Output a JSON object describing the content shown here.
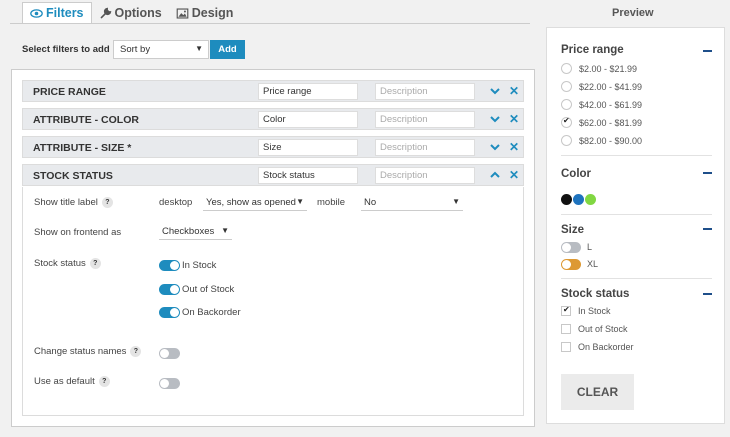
{
  "tabs": [
    {
      "label": "Filters",
      "icon": "eye-icon",
      "active": true
    },
    {
      "label": "Options",
      "icon": "wrench-icon",
      "active": false
    },
    {
      "label": "Design",
      "icon": "image-icon",
      "active": false
    }
  ],
  "toolbar": {
    "select_label": "Select filters to add",
    "sort_value": "Sort by",
    "add_label": "Add"
  },
  "filters": [
    {
      "title": "PRICE RANGE",
      "label_value": "Price range",
      "description_placeholder": "Description",
      "expanded": false
    },
    {
      "title": "ATTRIBUTE - COLOR",
      "label_value": "Color",
      "description_placeholder": "Description",
      "expanded": false
    },
    {
      "title": "ATTRIBUTE - SIZE *",
      "label_value": "Size",
      "description_placeholder": "Description",
      "expanded": false
    },
    {
      "title": "STOCK STATUS",
      "label_value": "Stock status",
      "description_placeholder": "Description",
      "expanded": true
    }
  ],
  "stock_options": {
    "show_title_label": "Show title label",
    "desktop_label": "desktop",
    "desktop_value": "Yes, show as opened",
    "mobile_label": "mobile",
    "mobile_value": "No",
    "show_frontend_label": "Show on frontend as",
    "frontend_value": "Checkboxes",
    "stock_status_label": "Stock status",
    "statuses": [
      {
        "label": "In Stock",
        "on": true
      },
      {
        "label": "Out of Stock",
        "on": true
      },
      {
        "label": "On Backorder",
        "on": true
      }
    ],
    "change_names_label": "Change status names",
    "change_names_on": false,
    "use_default_label": "Use as default",
    "use_default_on": false
  },
  "preview": {
    "title": "Preview",
    "price_range": {
      "heading": "Price range",
      "options": [
        {
          "label": "$2.00 - $21.99",
          "checked": false
        },
        {
          "label": "$22.00 - $41.99",
          "checked": false
        },
        {
          "label": "$42.00 - $61.99",
          "checked": false
        },
        {
          "label": "$62.00 - $81.99",
          "checked": true
        },
        {
          "label": "$82.00 - $90.00",
          "checked": false
        }
      ]
    },
    "color": {
      "heading": "Color",
      "swatches": [
        "#111111",
        "#1e73be",
        "#81d742"
      ]
    },
    "size": {
      "heading": "Size",
      "options": [
        {
          "label": "L",
          "color": "#b8bcc2"
        },
        {
          "label": "XL",
          "color": "#dd9933"
        }
      ]
    },
    "stock_status": {
      "heading": "Stock status",
      "options": [
        {
          "label": "In Stock",
          "checked": true
        },
        {
          "label": "Out of Stock",
          "checked": false
        },
        {
          "label": "On Backorder",
          "checked": false
        }
      ]
    },
    "clear_label": "CLEAR"
  },
  "colors": {
    "accent": "#1e8cbe",
    "row_bg": "#e8eaed"
  }
}
